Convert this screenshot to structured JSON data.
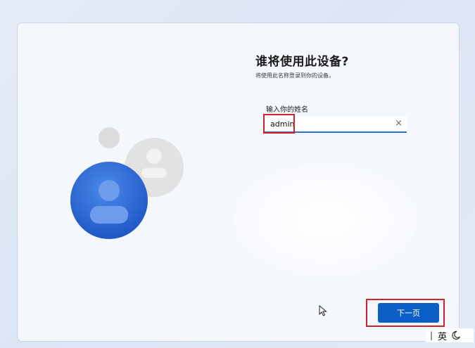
{
  "dialog": {
    "title": "谁将使用此设备?",
    "subtitle": "将使用此名称登录到你的设备。",
    "name_label": "输入你的姓名",
    "name_value": "admin",
    "clear_icon": "×",
    "next_label": "下一页"
  },
  "ime": {
    "separator": "|",
    "language": "英"
  },
  "colors": {
    "primary_button": "#0a5fc7",
    "highlight": "#d0222a",
    "avatar_blue": "#2f6fd8"
  },
  "icons": {
    "avatar_large": "user-avatar-icon",
    "avatar_small": "user-avatar-icon",
    "clear": "close-icon",
    "cursor": "mouse-pointer-icon",
    "ime_mode": "moon-icon"
  }
}
